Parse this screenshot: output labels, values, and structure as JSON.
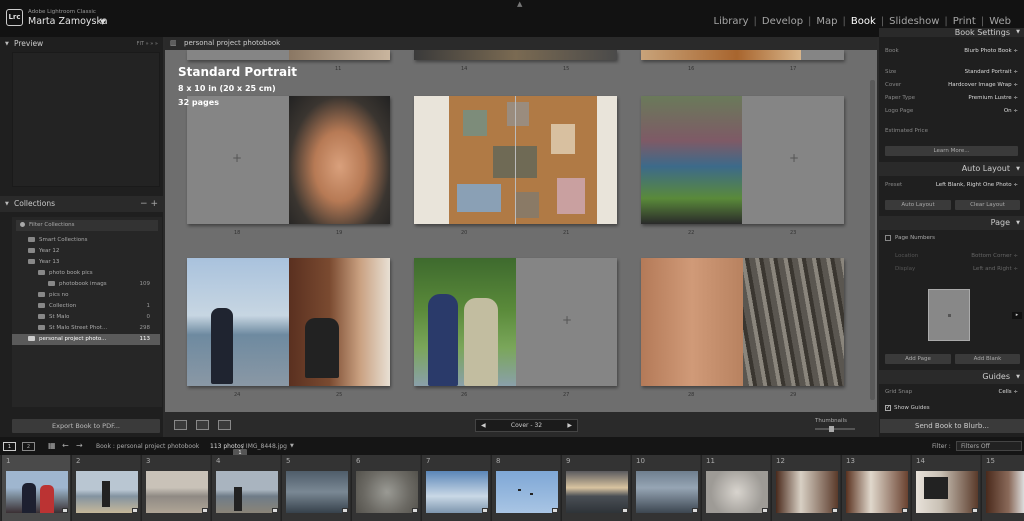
{
  "app": {
    "product": "Adobe Lightroom Classic",
    "logo": "Lrc",
    "user": "Marta Zamoyska"
  },
  "modules": [
    {
      "label": "Library"
    },
    {
      "label": "Develop"
    },
    {
      "label": "Map"
    },
    {
      "label": "Book",
      "active": true
    },
    {
      "label": "Slideshow"
    },
    {
      "label": "Print"
    },
    {
      "label": "Web"
    }
  ],
  "left": {
    "preview_title": "Preview",
    "preview_controls": "FIT  »  »  »",
    "collections_title": "Collections",
    "filter_label": "Filter Collections",
    "collections": [
      {
        "label": "Smart Collections",
        "count": ""
      },
      {
        "label": "Year 12",
        "count": ""
      },
      {
        "label": "Year 13",
        "count": ""
      },
      {
        "label": "photo book pics",
        "count": ""
      },
      {
        "label": "photobook imags",
        "count": "109"
      },
      {
        "label": "pics no",
        "count": ""
      },
      {
        "label": "Collection",
        "count": "1"
      },
      {
        "label": "St Malo",
        "count": "0"
      },
      {
        "label": "St Malo Street Phot...",
        "count": "298"
      },
      {
        "label": "personal project photo...",
        "count": "113",
        "selected": true
      }
    ],
    "export_label": "Export Book to PDF..."
  },
  "center": {
    "header": "personal project photobook",
    "book_title": "Standard Portrait",
    "book_size": "8 x 10 in (20 x 25 cm)",
    "book_pages": "32 pages",
    "top_page_numbers": [
      "11",
      "14",
      "15",
      "16",
      "17"
    ],
    "page_numbers": [
      "18",
      "19",
      "20",
      "21",
      "22",
      "23",
      "24",
      "25",
      "26",
      "27",
      "28",
      "29"
    ],
    "pager": "Cover - 32",
    "thumbnails_label": "Thumbnails"
  },
  "right": {
    "book_settings_title": "Book Settings",
    "book_rows": [
      {
        "label": "Book",
        "value": "Blurb Photo Book ÷"
      },
      {
        "label": "Size",
        "value": "Standard Portrait ÷"
      },
      {
        "label": "Cover",
        "value": "Hardcover Image Wrap ÷"
      },
      {
        "label": "Paper Type",
        "value": "Premium Lustre ÷"
      },
      {
        "label": "Logo Page",
        "value": "On ÷"
      }
    ],
    "estimated_price_label": "Estimated Price",
    "learn_more": "Learn More...",
    "auto_layout_title": "Auto Layout",
    "preset_label": "Preset",
    "preset_value": "Left Blank, Right One Photo ÷",
    "auto_layout_btn": "Auto Layout",
    "clear_layout_btn": "Clear Layout",
    "page_title": "Page",
    "page_numbers_label": "Page Numbers",
    "location_label": "Location",
    "location_value": "Bottom Corner ÷",
    "display_label": "Display",
    "display_value": "Left and Right ÷",
    "add_page": "Add Page",
    "add_blank": "Add Blank",
    "guides_title": "Guides",
    "grid_snap_label": "Grid Snap",
    "grid_snap_value": "Cells ÷",
    "show_guides": "Show Guides",
    "send_btn": "Send Book to Blurb..."
  },
  "filmstrip": {
    "page_buttons": [
      "1",
      "2"
    ],
    "source": "Book : personal project photobook",
    "count": "113 photos",
    "current": "/ IMG_8448.jpg",
    "filter_label": "Filter :",
    "filter_value": "Filters Off",
    "tooltip": "1",
    "thumbs": [
      "1",
      "2",
      "3",
      "4",
      "5",
      "6",
      "7",
      "8",
      "9",
      "10",
      "11",
      "12",
      "13",
      "14",
      "15"
    ]
  }
}
